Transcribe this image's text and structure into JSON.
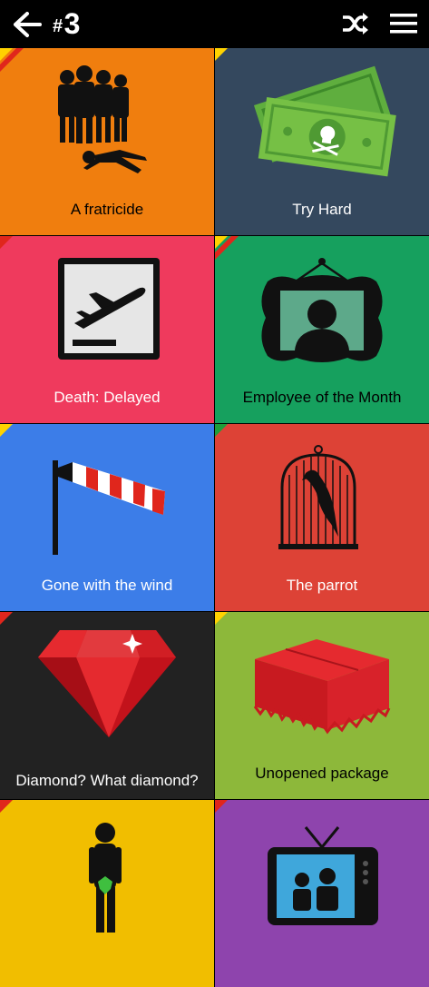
{
  "header": {
    "hash": "#",
    "level": "3",
    "back_icon": "arrow-left-icon",
    "shuffle_icon": "shuffle-icon",
    "menu_icon": "hamburger-menu-icon"
  },
  "tiles": [
    {
      "label": "A fratricide",
      "color": "#F07E0E",
      "stripes": [
        "#FFD200",
        "#E0261C"
      ]
    },
    {
      "label": "Try Hard",
      "color": "#34485E",
      "stripes": [
        "#FFD200"
      ]
    },
    {
      "label": "Death: Delayed",
      "color": "#EF3A5D",
      "stripes": [
        "#E0261C"
      ]
    },
    {
      "label": "Employee of the Month",
      "color": "#16A05E",
      "stripes": [
        "#FFD200",
        "#E0261C"
      ]
    },
    {
      "label": "Gone with the wind",
      "color": "#3C7DE8",
      "stripes": [
        "#FFD200"
      ]
    },
    {
      "label": "The parrot",
      "color": "#DD4236",
      "stripes": [
        "#1E9E3A"
      ]
    },
    {
      "label": "Diamond? What diamond?",
      "color": "#222222",
      "stripes": [
        "#E0261C"
      ]
    },
    {
      "label": "Unopened package",
      "color": "#8DB83A",
      "stripes": [
        "#FFD200"
      ]
    },
    {
      "label": "",
      "color": "#F1BE00",
      "stripes": [
        "#E0261C"
      ]
    },
    {
      "label": "",
      "color": "#8E44AD",
      "stripes": [
        "#E0261C"
      ]
    }
  ]
}
